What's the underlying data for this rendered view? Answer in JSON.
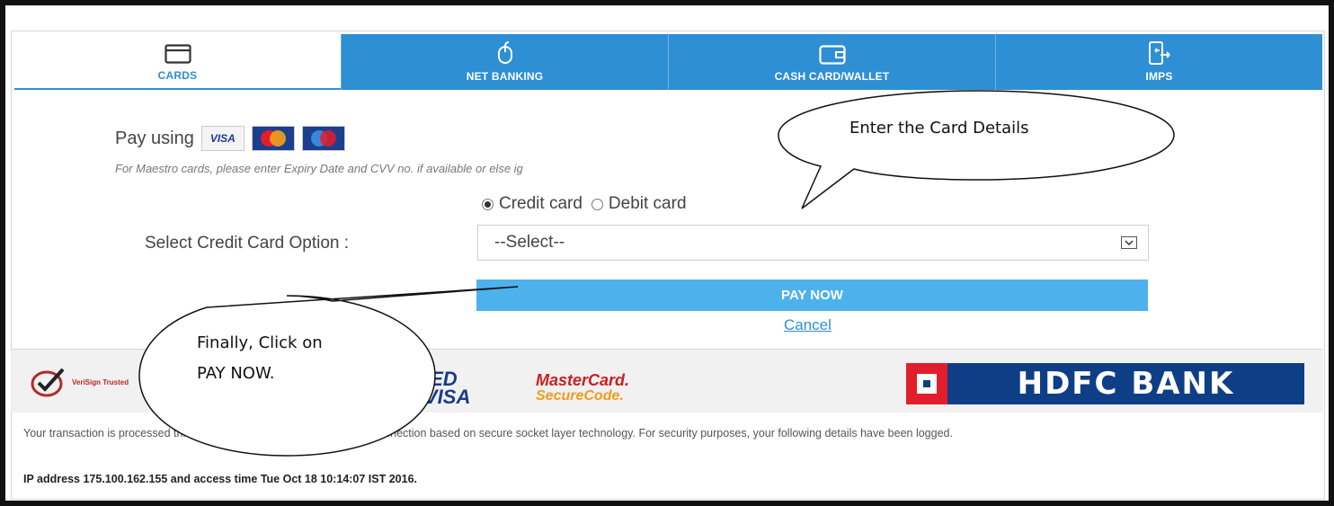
{
  "tabs": [
    {
      "label": "CARDS",
      "icon": "credit-card-icon",
      "active": true
    },
    {
      "label": "NET BANKING",
      "icon": "mouse-icon",
      "active": false
    },
    {
      "label": "CASH CARD/WALLET",
      "icon": "wallet-icon",
      "active": false
    },
    {
      "label": "IMPS",
      "icon": "mobile-transfer-icon",
      "active": false
    }
  ],
  "pay_using": {
    "label": "Pay using",
    "logos": [
      "VISA",
      "MasterCard",
      "Maestro"
    ]
  },
  "maestro_note": "For Maestro cards, please enter Expiry Date and CVV no. if available or else ig",
  "card_type": {
    "options": [
      "Credit card",
      "Debit card"
    ],
    "selected": "Credit card"
  },
  "select": {
    "label": "Select Credit Card Option :",
    "value": "--Select--"
  },
  "actions": {
    "pay_now": "PAY NOW",
    "cancel": "Cancel"
  },
  "footer": {
    "verisign": "VeriSign Trusted",
    "vbv": [
      "IED",
      "VISA"
    ],
    "mastercard": [
      "MasterCard.",
      "SecureCode."
    ],
    "bank": "HDFC BANK",
    "secure_text": "Your transaction is processed through a secure 2048 bit https internet connection based on secure socket layer technology. For security purposes, your following details have been logged.",
    "ip_text": "IP address 175.100.162.155 and access time Tue Oct 18 10:14:07 IST 2016."
  },
  "callouts": {
    "top": "Enter the Card Details",
    "bottom_line1": "Finally, Click on",
    "bottom_line2": "PAY NOW."
  },
  "colors": {
    "tab_blue": "#2e8fd4",
    "pay_button": "#4db2ec",
    "hdfc_blue": "#0e3e86",
    "hdfc_red": "#e21d2c"
  }
}
